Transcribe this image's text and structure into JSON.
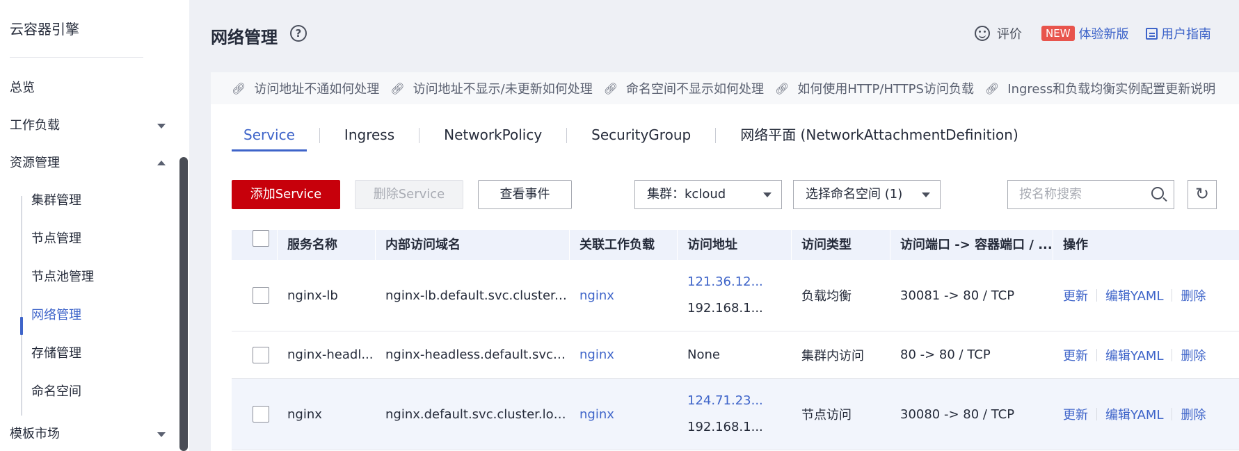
{
  "sidebar": {
    "brand": "云容器引擎",
    "items": [
      {
        "label": "总览"
      },
      {
        "label": "工作负载"
      },
      {
        "label": "资源管理"
      }
    ],
    "sub_items": [
      {
        "label": "集群管理"
      },
      {
        "label": "节点管理"
      },
      {
        "label": "节点池管理"
      },
      {
        "label": "网络管理"
      },
      {
        "label": "存储管理"
      },
      {
        "label": "命名空间"
      }
    ],
    "bottom_item": {
      "label": "模板市场"
    }
  },
  "header": {
    "title": "网络管理",
    "help_icon": "?",
    "feedback_label": "评价",
    "new_badge": "NEW",
    "new_version_label": "体验新版",
    "guide_label": "用户指南"
  },
  "help_links": [
    "访问地址不通如何处理",
    "访问地址不显示/未更新如何处理",
    "命名空间不显示如何处理",
    "如何使用HTTP/HTTPS访问负载",
    "Ingress和负载均衡实例配置更新说明"
  ],
  "tabs": [
    "Service",
    "Ingress",
    "NetworkPolicy",
    "SecurityGroup",
    "网络平面 (NetworkAttachmentDefinition)"
  ],
  "toolbar": {
    "add_label": "添加Service",
    "delete_label": "删除Service",
    "events_label": "查看事件",
    "cluster_select": "集群：kcloud",
    "namespace_select": "选择命名空间 (1)",
    "search_placeholder": "按名称搜索",
    "refresh_icon": "↻"
  },
  "table": {
    "headers": [
      "服务名称",
      "内部访问域名",
      "关联工作负载",
      "访问地址",
      "访问类型",
      "访问端口 -> 容器端口 / ...",
      "操作"
    ],
    "rows": [
      {
        "name": "nginx-lb",
        "domain": "nginx-lb.default.svc.cluster.lo...",
        "workload": "nginx",
        "addr1": "121.36.12...",
        "addr2": "192.168.1...",
        "type": "负载均衡",
        "ports": "30081 -> 80 / TCP"
      },
      {
        "name": "nginx-headl...",
        "domain": "nginx-headless.default.svc.cl...",
        "workload": "nginx",
        "addr1": "None",
        "addr2": "",
        "type": "集群内访问",
        "ports": "80 -> 80 / TCP"
      },
      {
        "name": "nginx",
        "domain": "nginx.default.svc.cluster.local",
        "workload": "nginx",
        "addr1": "124.71.23...",
        "addr2": "192.168.1...",
        "type": "节点访问",
        "ports": "30080 -> 80 / TCP"
      }
    ],
    "ops": {
      "update": "更新",
      "edit_yaml": "编辑YAML",
      "delete": "删除"
    }
  },
  "colors": {
    "accent": "#3e64c9",
    "brand_red": "#c7000b",
    "new_badge": "#e8544c"
  }
}
